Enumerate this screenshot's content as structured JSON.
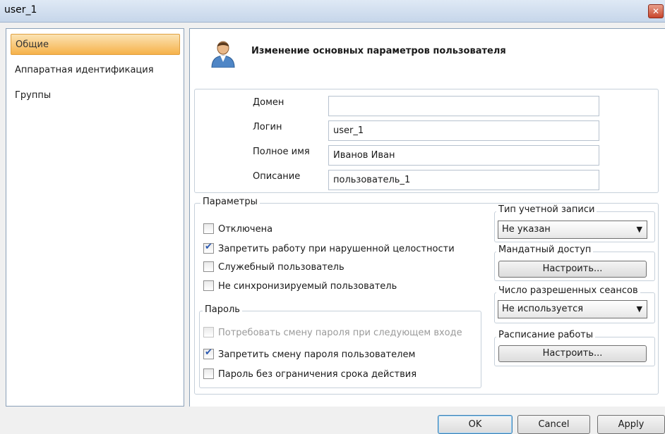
{
  "window": {
    "title": "user_1",
    "close_label": "x"
  },
  "sidebar": {
    "items": [
      {
        "label": "Общие"
      },
      {
        "label": "Аппаратная идентификация"
      },
      {
        "label": "Группы"
      }
    ]
  },
  "header": {
    "title": "Изменение основных параметров пользователя"
  },
  "fields": {
    "domain": {
      "label": "Домен",
      "value": ""
    },
    "login": {
      "label": "Логин",
      "value": "user_1"
    },
    "fullname": {
      "label": "Полное имя",
      "value": "Иванов Иван"
    },
    "description": {
      "label": "Описание",
      "value": "пользователь_1"
    }
  },
  "params": {
    "legend": "Параметры",
    "checkboxes": [
      {
        "label": "Отключена",
        "checked": false
      },
      {
        "label": "Запретить работу при нарушенной целостности",
        "checked": true
      },
      {
        "label": "Служебный пользователь",
        "checked": false
      },
      {
        "label": "Не синхронизируемый пользователь",
        "checked": false
      }
    ]
  },
  "password": {
    "legend": "Пароль",
    "checkboxes": [
      {
        "label": "Потребовать смену пароля при следующем входе",
        "checked": false,
        "disabled": true
      },
      {
        "label": "Запретить смену пароля пользователем",
        "checked": true
      },
      {
        "label": "Пароль без ограничения срока действия",
        "checked": false
      }
    ]
  },
  "account_type": {
    "legend": "Тип учетной записи",
    "value": "Не указан"
  },
  "mandatory": {
    "legend": "Мандатный доступ",
    "button": "Настроить..."
  },
  "sessions": {
    "legend": "Число разрешенных сеансов",
    "value": "Не используется"
  },
  "schedule": {
    "legend": "Расписание работы",
    "button": "Настроить..."
  },
  "footer": {
    "ok": "OK",
    "cancel": "Cancel",
    "apply": "Apply"
  },
  "colors": {
    "accent_selected": "#f6b24a",
    "title_bar": "#c6d6ea",
    "check": "#2a58b0"
  },
  "icons": {
    "user": "user-icon",
    "close": "close-icon",
    "dropdown": "chevron-down-icon"
  }
}
